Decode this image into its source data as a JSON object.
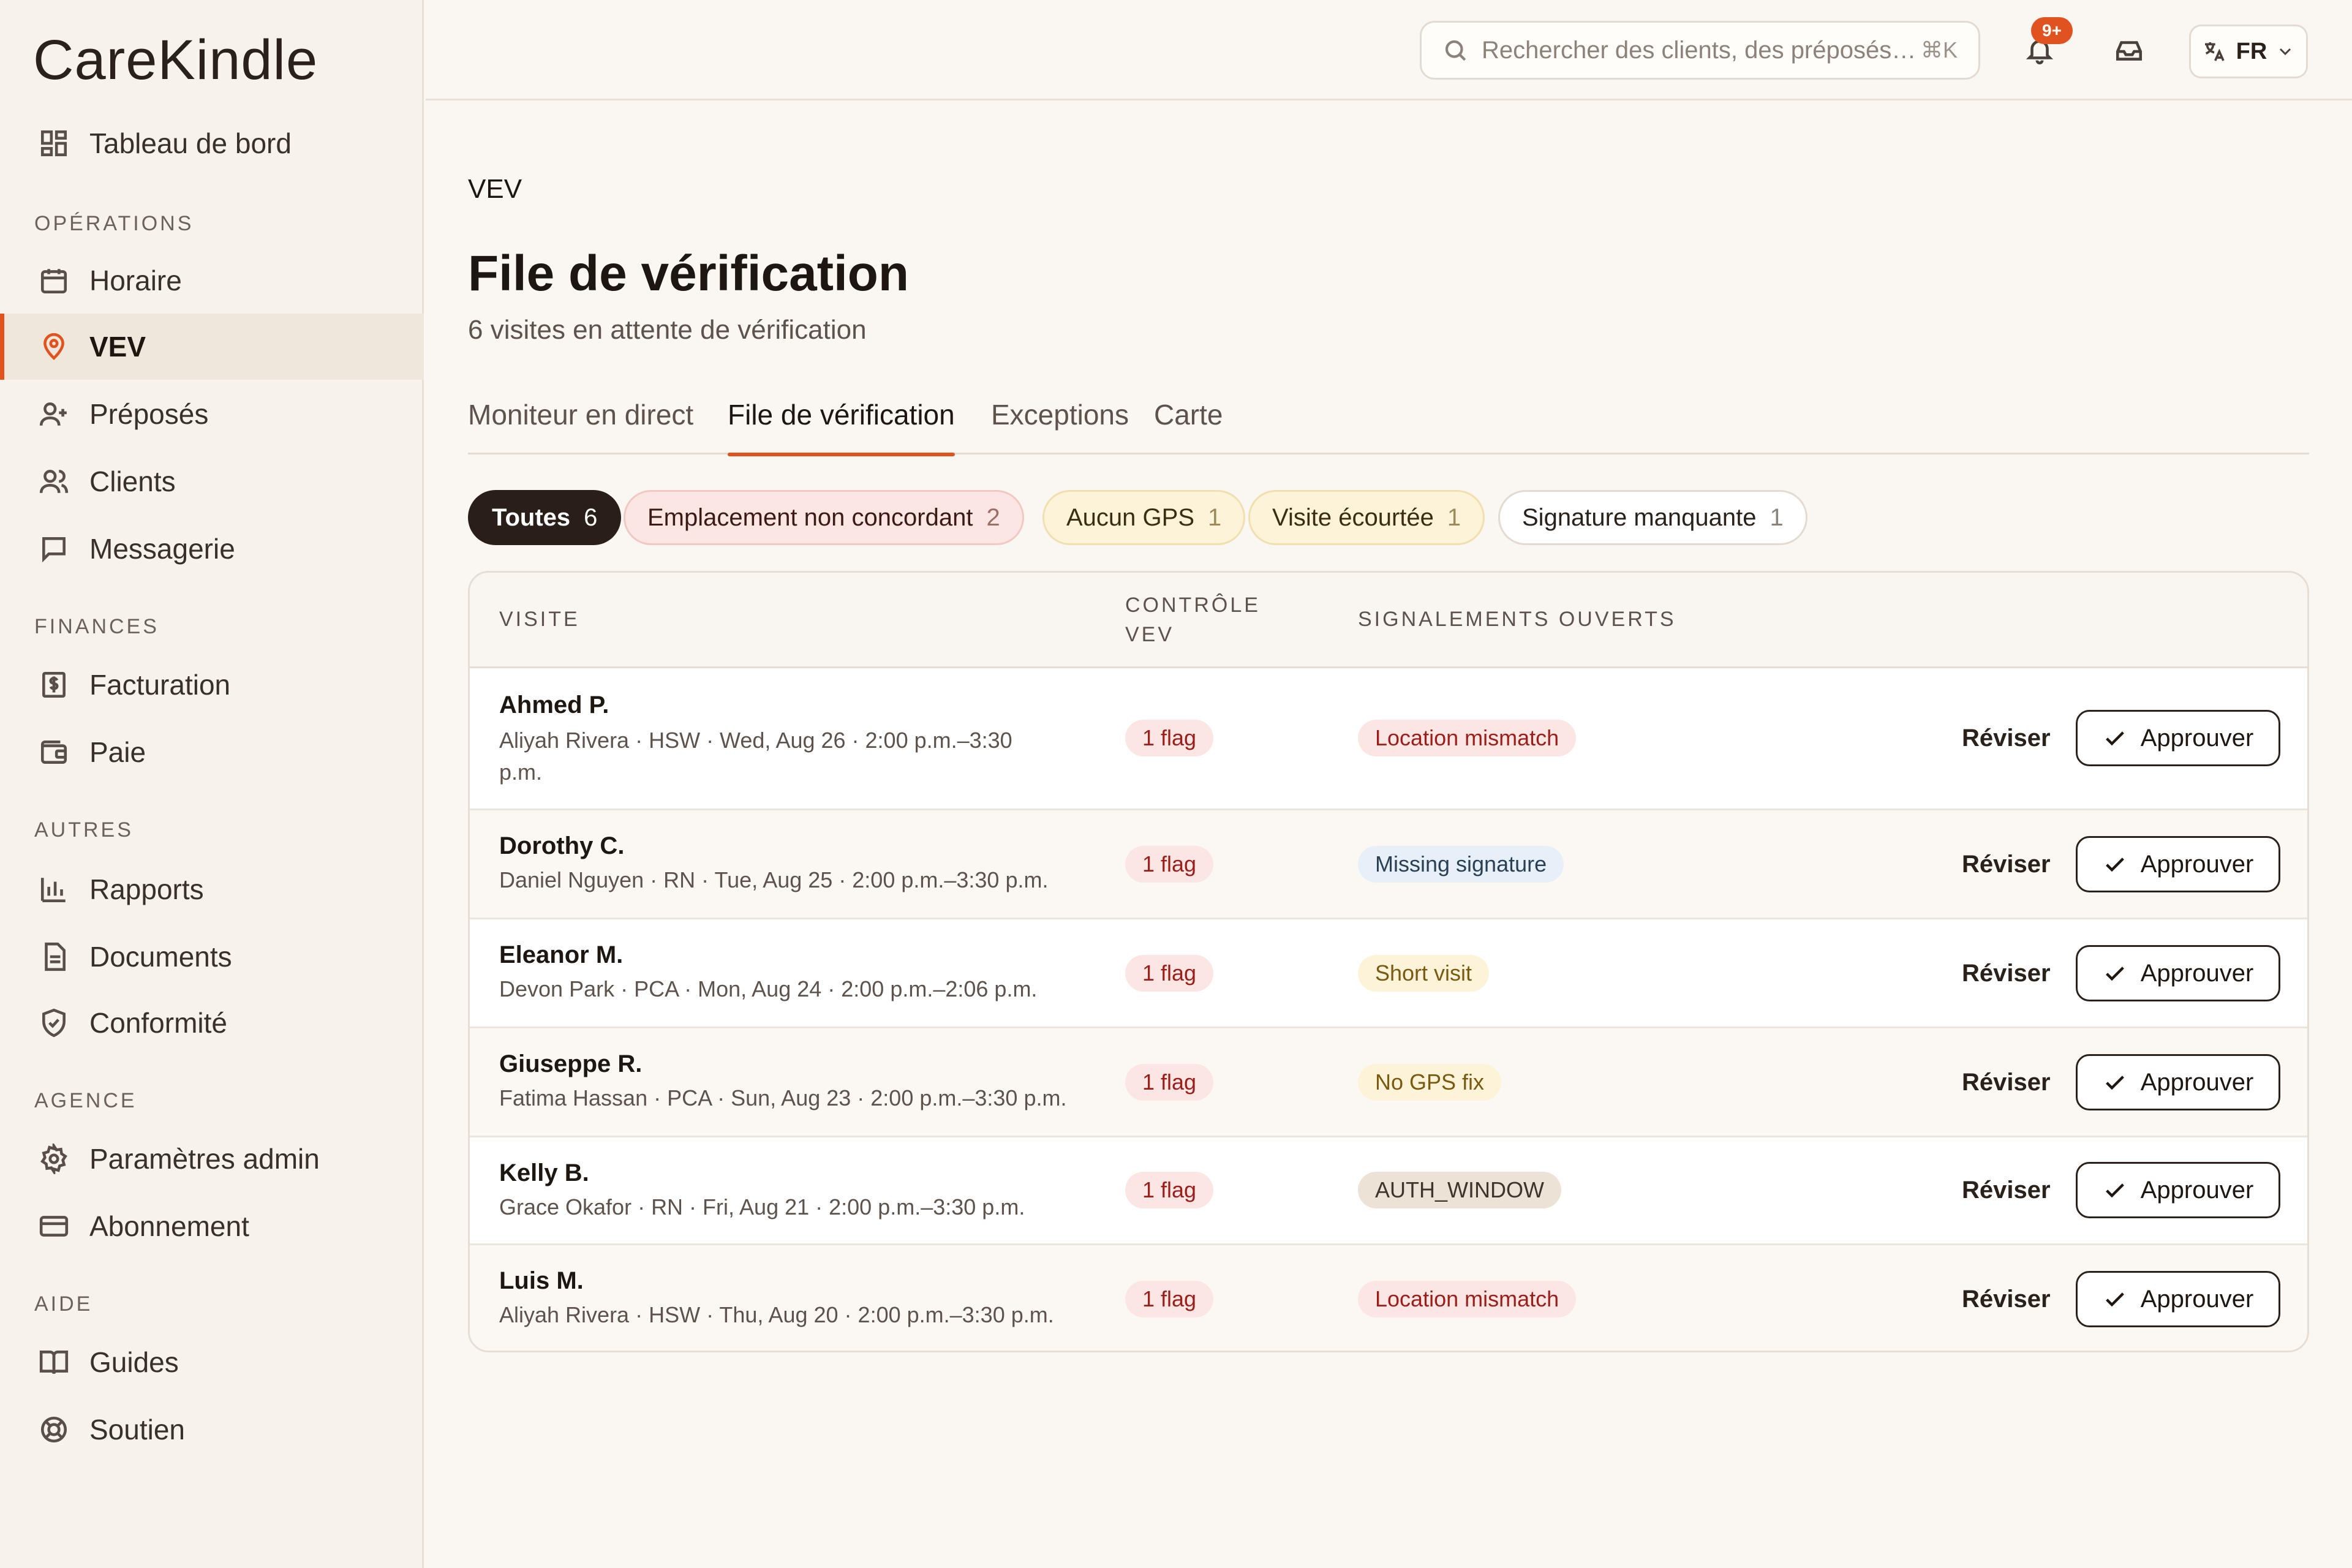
{
  "app": {
    "logo": "CareKindle"
  },
  "sidebar": {
    "dashboard": "Tableau de bord",
    "sections": {
      "operations": "OPÉRATIONS",
      "finances": "FINANCES",
      "autres": "AUTRES",
      "agence": "AGENCE",
      "aide": "AIDE"
    },
    "items": {
      "horaire": "Horaire",
      "vev": "VEV",
      "preposes": "Préposés",
      "clients": "Clients",
      "messagerie": "Messagerie",
      "facturation": "Facturation",
      "paie": "Paie",
      "rapports": "Rapports",
      "documents": "Documents",
      "conformite": "Conformité",
      "parametres": "Paramètres admin",
      "abonnement": "Abonnement",
      "guides": "Guides",
      "soutien": "Soutien"
    }
  },
  "topbar": {
    "search_placeholder": "Rechercher des clients, des préposés…",
    "search_shortcut": "⌘K",
    "notifications_badge": "9+",
    "language": "FR"
  },
  "page": {
    "breadcrumb": "VEV",
    "title": "File de vérification",
    "subtitle": "6 visites en attente de vérification"
  },
  "tabs": [
    "Moniteur en direct",
    "File de vérification",
    "Exceptions",
    "Carte"
  ],
  "filters": [
    {
      "label": "Toutes",
      "count": "6"
    },
    {
      "label": "Emplacement non concordant",
      "count": "2"
    },
    {
      "label": "Aucun GPS",
      "count": "1"
    },
    {
      "label": "Visite écourtée",
      "count": "1"
    },
    {
      "label": "Signature manquante",
      "count": "1"
    }
  ],
  "table": {
    "headers": {
      "visit": "VISITE",
      "check_line1": "CONTRÔLE",
      "check_line2": "VEV",
      "flags": "SIGNALEMENTS OUVERTS"
    },
    "review_label": "Réviser",
    "approve_label": "Approuver",
    "rows": [
      {
        "name": "Ahmed P.",
        "meta": "Aliyah Rivera · HSW · Wed, Aug 26 · 2:00 p.m.–3:30 p.m.",
        "flag": "1 flag",
        "issue": "Location mismatch"
      },
      {
        "name": "Dorothy C.",
        "meta": "Daniel Nguyen · RN · Tue, Aug 25 · 2:00 p.m.–3:30 p.m.",
        "flag": "1 flag",
        "issue": "Missing signature"
      },
      {
        "name": "Eleanor M.",
        "meta": "Devon Park · PCA · Mon, Aug 24 · 2:00 p.m.–2:06 p.m.",
        "flag": "1 flag",
        "issue": "Short visit"
      },
      {
        "name": "Giuseppe R.",
        "meta": "Fatima Hassan · PCA · Sun, Aug 23 · 2:00 p.m.–3:30 p.m.",
        "flag": "1 flag",
        "issue": "No GPS fix"
      },
      {
        "name": "Kelly B.",
        "meta": "Grace Okafor · RN · Fri, Aug 21 · 2:00 p.m.–3:30 p.m.",
        "flag": "1 flag",
        "issue": "AUTH_WINDOW"
      },
      {
        "name": "Luis M.",
        "meta": "Aliyah Rivera · HSW · Thu, Aug 20 · 2:00 p.m.–3:30 p.m.",
        "flag": "1 flag",
        "issue": "Location mismatch"
      }
    ]
  },
  "colors": {
    "accent": "#e0531f",
    "flag_bg": "#fbe6e4",
    "flag_text": "#9b1e1a"
  }
}
